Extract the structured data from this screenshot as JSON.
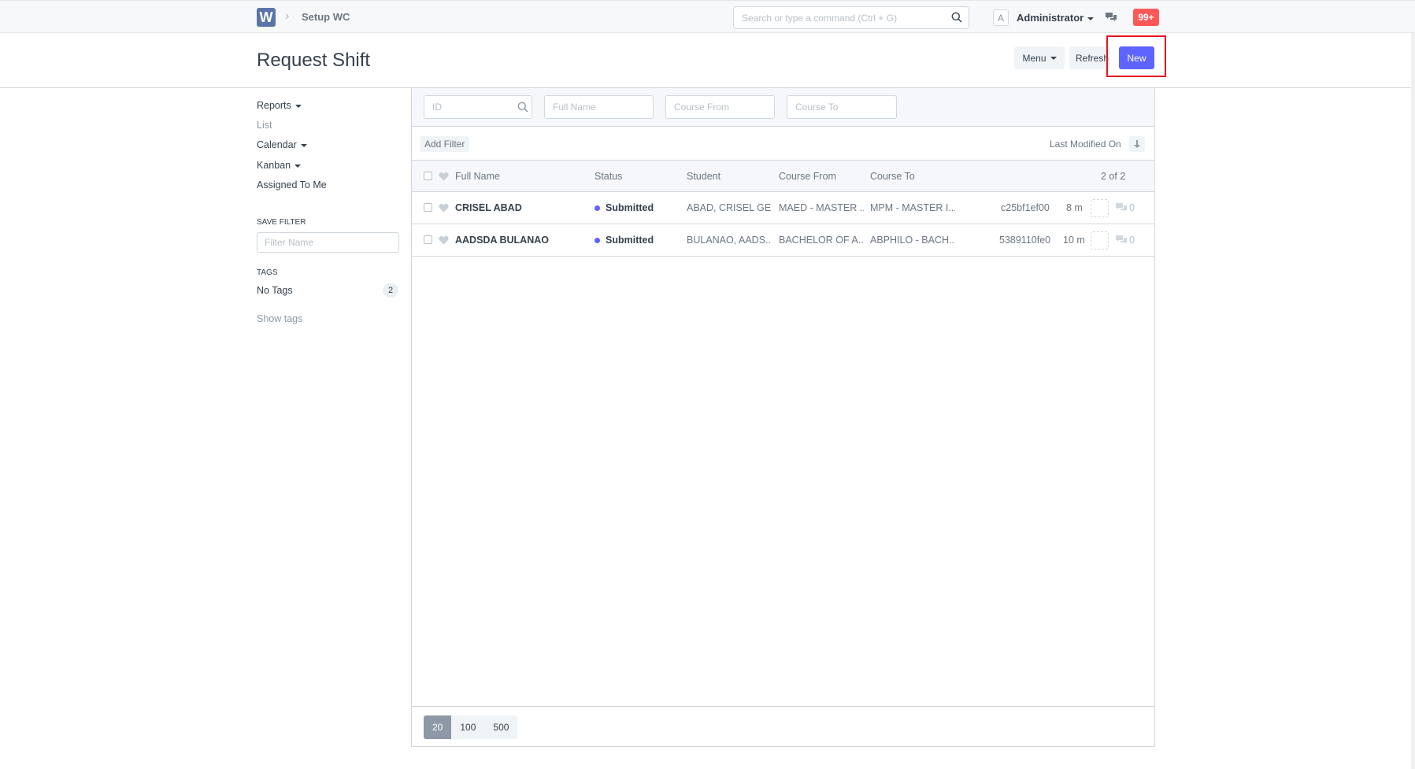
{
  "navbar": {
    "logo_letter": "W",
    "breadcrumb": "Setup WC",
    "search_placeholder": "Search or type a command (Ctrl + G)",
    "avatar_letter": "A",
    "user_name": "Administrator",
    "notification_count": "99+"
  },
  "page": {
    "title": "Request Shift",
    "menu_label": "Menu",
    "refresh_label": "Refresh",
    "new_label": "New"
  },
  "sidebar": {
    "reports": "Reports",
    "list": "List",
    "calendar": "Calendar",
    "kanban": "Kanban",
    "assigned_to_me": "Assigned To Me",
    "save_filter_label": "SAVE FILTER",
    "filter_name_placeholder": "Filter Name",
    "tags_label": "TAGS",
    "no_tags": "No Tags",
    "no_tags_count": "2",
    "show_tags": "Show tags"
  },
  "filters": {
    "id_placeholder": "ID",
    "full_name_placeholder": "Full Name",
    "course_from_placeholder": "Course From",
    "course_to_placeholder": "Course To",
    "add_filter": "Add Filter",
    "sort_label": "Last Modified On"
  },
  "list": {
    "columns": {
      "full_name": "Full Name",
      "status": "Status",
      "student": "Student",
      "course_from": "Course From",
      "course_to": "Course To"
    },
    "count": "2 of 2",
    "rows": [
      {
        "full_name": "CRISEL ABAD",
        "status": "Submitted",
        "student": "ABAD, CRISEL GE...",
        "course_from": "MAED - MASTER ...",
        "course_to": "MPM - MASTER I...",
        "id": "c25bf1ef00",
        "modified": "8 m",
        "comments": "0"
      },
      {
        "full_name": "AADSDA BULANAO",
        "status": "Submitted",
        "student": "BULANAO, AADS...",
        "course_from": "BACHELOR OF A...",
        "course_to": "ABPHILO - BACH...",
        "id": "5389110fe0",
        "modified": "10 m",
        "comments": "0"
      }
    ]
  },
  "paging": {
    "options": [
      "20",
      "100",
      "500"
    ]
  },
  "colors": {
    "primary": "#5e64ff",
    "notification": "#ff5858",
    "highlight": "#e8141b"
  }
}
